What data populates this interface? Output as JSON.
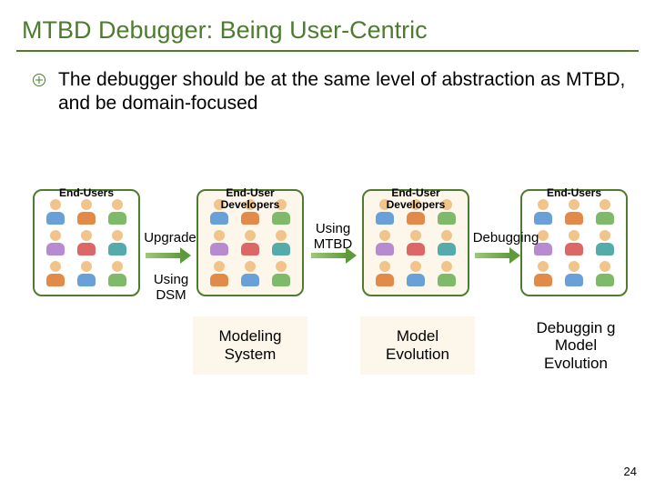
{
  "title": "MTBD Debugger: Being User-Centric",
  "bullet_text": "The debugger should be at the same level of abstraction as MTBD, and be domain-focused",
  "groups": {
    "g1_label": "End-Users",
    "g2_label": "End-User Developers",
    "g3_label": "End-User Developers",
    "g4_label": "End-Users"
  },
  "arrows": {
    "upgrade": "Upgrade",
    "using_mtbd": "Using MTBD",
    "debugging": "Debugging",
    "using_dsm": "Using DSM"
  },
  "panels": {
    "modeling_system": "Modeling System",
    "model_evolution": "Model Evolution",
    "debugging_model_evolution": "Debuggin g Model Evolution"
  },
  "page_number": "24"
}
